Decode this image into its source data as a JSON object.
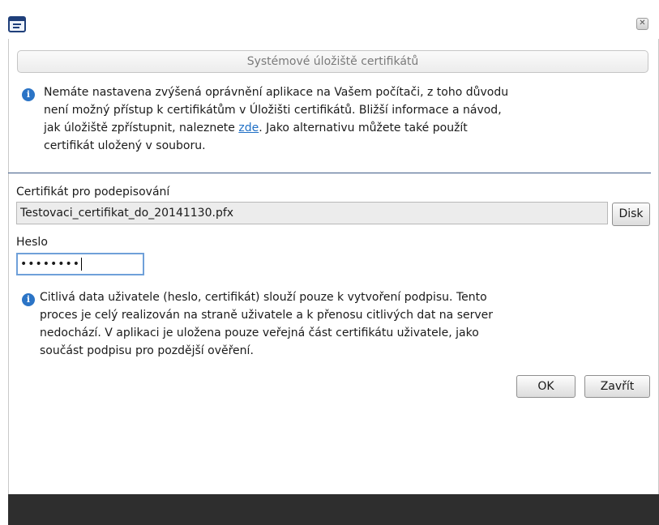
{
  "window": {
    "app_icon": "dialog-window-icon",
    "close_icon": "close-icon",
    "close_glyph": "✕"
  },
  "certificate_store": {
    "header": "Systémové úložiště certifikátů",
    "info_icon": "info-icon",
    "info_lines": [
      "Nemáte nastavena zvýšená oprávnění aplikace na Vašem počítači, z toho důvodu",
      "není možný přístup k certifikátům v Úložišti certifikátů. Bližší informace a návod,",
      "jak úložiště zpřístupnit, naleznete "
    ],
    "info_link": "zde",
    "info_after_link": ". Jako alternativu můžete také použít",
    "info_last_line": "certifikát uložený v souboru."
  },
  "signing": {
    "certificate_label": "Certifikát pro podepisování",
    "certificate_value": "Testovaci_certifikat_do_20141130.pfx",
    "disk_button": "Disk",
    "password_label": "Heslo",
    "password_mask": "••••••••"
  },
  "privacy_note": {
    "info_icon": "info-icon",
    "lines": [
      "Citlivá data uživatele (heslo, certifikát) slouží pouze k vytvoření podpisu. Tento",
      "proces je celý realizován na straně uživatele a k přenosu citlivých dat na server",
      "nedochází. V aplikaci je uložena pouze veřejná část certifikátu uživatele, jako",
      "součást podpisu pro pozdější ověření."
    ]
  },
  "actions": {
    "ok": "OK",
    "close": "Zavřít"
  },
  "colors": {
    "accent": "#2b74c6",
    "link": "#1f6fc5",
    "divider": "#3e5a86",
    "footer": "#2e2e2e"
  }
}
